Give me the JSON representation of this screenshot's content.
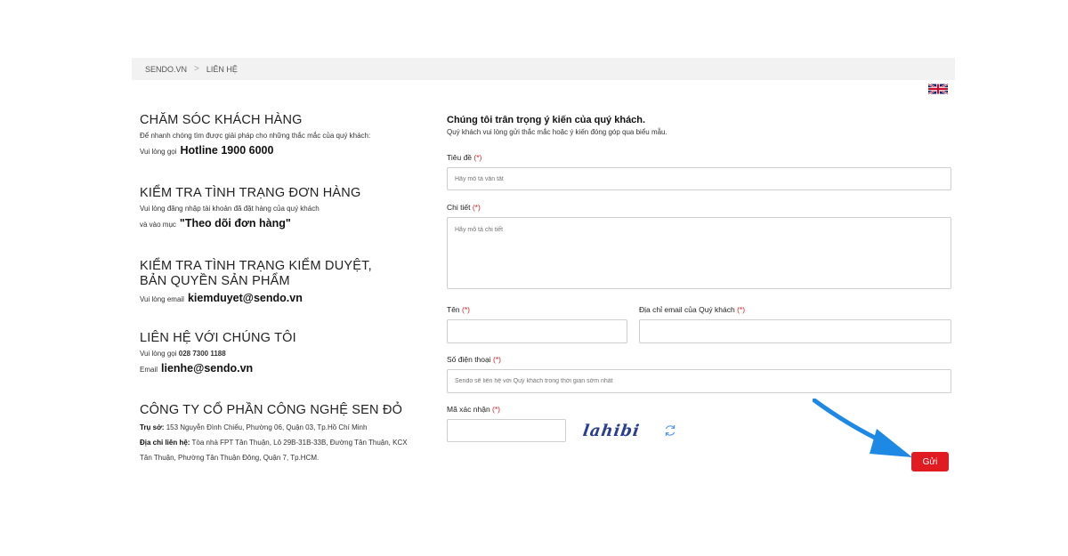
{
  "breadcrumb": {
    "home": "SENDO.VN",
    "separator": ">",
    "current": "LIÊN HỆ"
  },
  "left": {
    "customer_care": {
      "title": "CHĂM SÓC KHÁCH HÀNG",
      "desc": "Để nhanh chóng tìm được giải pháp cho những thắc mắc của quý khách:",
      "call_prefix": "Vui lòng gọi",
      "hotline": "Hotline 1900 6000"
    },
    "order_status": {
      "title": "KIỂM TRA TÌNH TRẠNG ĐƠN HÀNG",
      "desc": "Vui lòng đăng nhập tài khoản đã đặt hàng của quý khách",
      "prefix": "và vào mục",
      "link": "\"Theo dõi đơn hàng\""
    },
    "review": {
      "title_line1": "KIỂM TRA TÌNH TRẠNG KIỂM DUYỆT,",
      "title_line2": "BẢN QUYỀN SẢN PHẨM",
      "prefix": "Vui lòng email",
      "email": "kiemduyet@sendo.vn"
    },
    "contact": {
      "title": "LIÊN HỆ VỚI CHÚNG TÔI",
      "phone_prefix": "Vui lòng gọi",
      "phone": "028 7300 1188",
      "email_prefix": "Email",
      "email": "lienhe@sendo.vn"
    },
    "company": {
      "title": "CÔNG TY CỔ PHẦN CÔNG NGHỆ SEN ĐỎ",
      "hq_label": "Trụ sở:",
      "hq": "153 Nguyễn Đình Chiểu, Phường 06, Quận 03, Tp.Hồ Chí Minh",
      "addr_label": "Địa chỉ liên hệ:",
      "addr_line1": "Tòa nhà FPT Tân Thuận, Lô 29B-31B-33B, Đường Tân Thuận, KCX",
      "addr_line2": "Tân Thuận, Phường Tân Thuận Đông, Quận 7, Tp.HCM."
    }
  },
  "form": {
    "heading": "Chúng tôi trân trọng ý kiến của quý khách.",
    "subheading": "Quý khách vui lòng gửi thắc mắc hoặc ý kiến đóng góp qua biểu mẫu.",
    "required_mark": "(*)",
    "subject": {
      "label": "Tiêu đề",
      "placeholder": "Hãy mô tả vắn tắt"
    },
    "detail": {
      "label": "Chi tiết",
      "placeholder": "Hãy mô tả chi tiết"
    },
    "name": {
      "label": "Tên",
      "value": ""
    },
    "email": {
      "label": "Địa chỉ email của Quý khách",
      "value": ""
    },
    "phone": {
      "label": "Số điện thoại",
      "placeholder": "Sendo sẽ liên hệ với Quý khách trong thời gian sớm nhất"
    },
    "captcha": {
      "label": "Mã xác nhận",
      "value": "",
      "image_text": "lahibi"
    },
    "submit_label": "Gửi"
  },
  "colors": {
    "accent": "#e11b22",
    "arrow": "#1e88e5",
    "breadcrumb_bg": "#f2f2f2"
  },
  "icons": [
    "uk-flag-icon",
    "refresh-icon",
    "pointer-arrow-icon"
  ]
}
